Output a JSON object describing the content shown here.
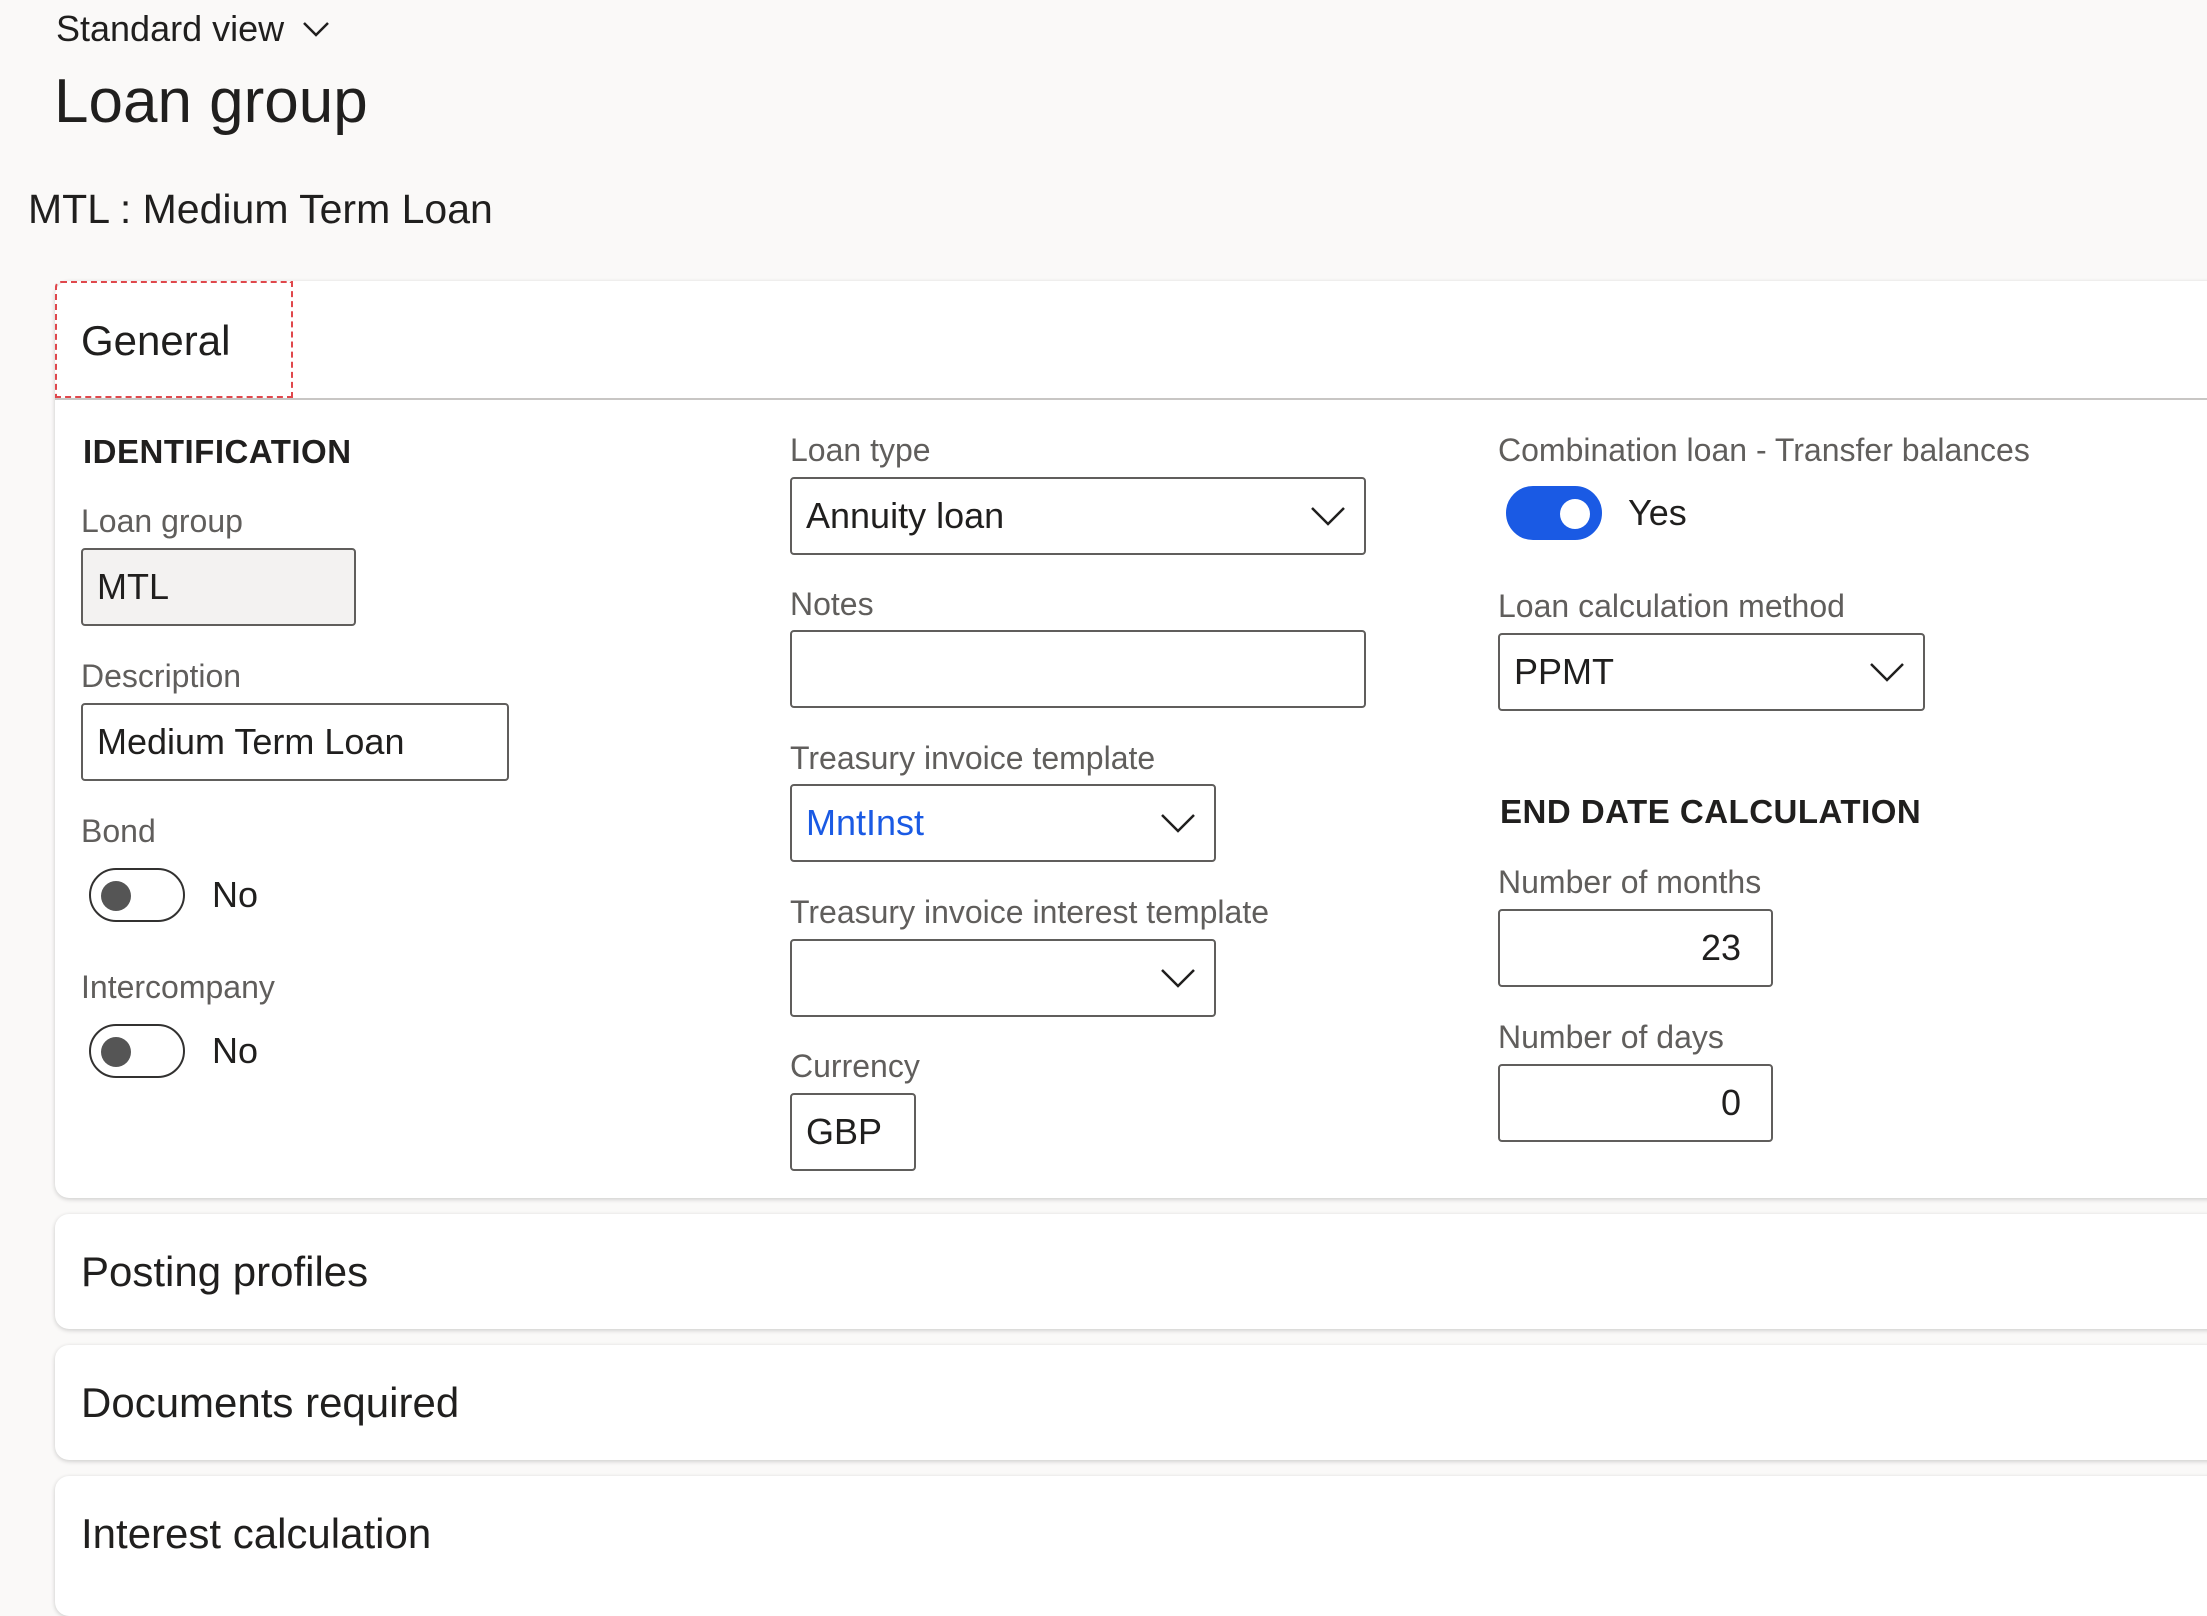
{
  "header": {
    "view_label": "Standard view",
    "page_title": "Loan group",
    "record_title": "MTL : Medium Term Loan"
  },
  "general": {
    "tab_label": "General",
    "identification": {
      "section_label": "IDENTIFICATION",
      "loan_group_label": "Loan group",
      "loan_group_value": "MTL",
      "description_label": "Description",
      "description_value": "Medium Term Loan",
      "bond_label": "Bond",
      "bond_value": "No",
      "bond_on": false,
      "intercompany_label": "Intercompany",
      "intercompany_value": "No",
      "intercompany_on": false
    },
    "middle": {
      "loan_type_label": "Loan type",
      "loan_type_value": "Annuity loan",
      "notes_label": "Notes",
      "notes_value": "",
      "invoice_template_label": "Treasury invoice template",
      "invoice_template_value": "MntInst",
      "interest_template_label": "Treasury invoice interest template",
      "interest_template_value": "",
      "currency_label": "Currency",
      "currency_value": "GBP"
    },
    "right": {
      "combination_label": "Combination loan - Transfer balances",
      "combination_value": "Yes",
      "combination_on": true,
      "calc_method_label": "Loan calculation method",
      "calc_method_value": "PPMT",
      "end_date_section": "END DATE CALCULATION",
      "months_label": "Number of months",
      "months_value": "23",
      "days_label": "Number of days",
      "days_value": "0"
    }
  },
  "sections": {
    "posting_profiles": "Posting profiles",
    "documents_required": "Documents required",
    "interest_calculation": "Interest calculation"
  },
  "colors": {
    "accent": "#1a5ae4",
    "focus_outline": "#e0474c",
    "background": "#faf9f8"
  }
}
